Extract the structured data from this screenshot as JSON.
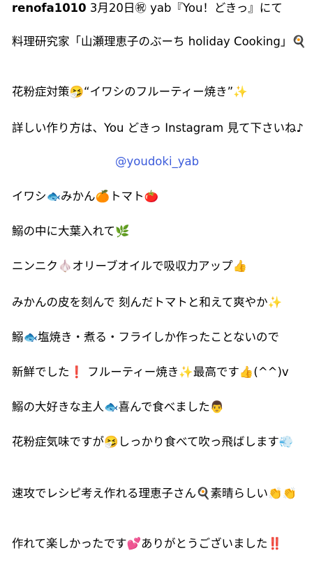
{
  "post": {
    "username": "renofa1010",
    "header_rest": " 3月20日㊗ yab『You！どきっ』にて",
    "lines": [
      "料理研究家「山瀬理恵子のぶーち holiday Cooking」🍳",
      "花粉症対策🤧“イワシのフルーティー焼き”✨",
      "詳しい作り方は、You どきっ Instagram 見て下さいね♪",
      "イワシ🐟みかん🍊トマト🍅",
      "鰯の中に大葉入れて🌿",
      "ニンニク🧄オリーブオイルで吸収力アップ👍",
      "みかんの皮を刻んで 刻んだトマトと和えて爽やか✨",
      "鰯🐟塩焼き・煮る・フライしか作ったことないので",
      "新鮮でした❗️ フルーティー焼き✨最高です👍(^^)v",
      "鰯の大好きな主人🐟喜んで食べました👨",
      "花粉症気味ですが🤧しっかり食べて吹っ飛ばします💨",
      "速攻でレシピ考え作れる理恵子さん🍳素晴らしい👏👏",
      "作れて楽しかったです💕ありがとうございました‼️"
    ],
    "mention": "@youdoki_yab"
  },
  "colors": {
    "text": "#000000",
    "mention": "#3b5bdb",
    "background": "#ffffff"
  }
}
